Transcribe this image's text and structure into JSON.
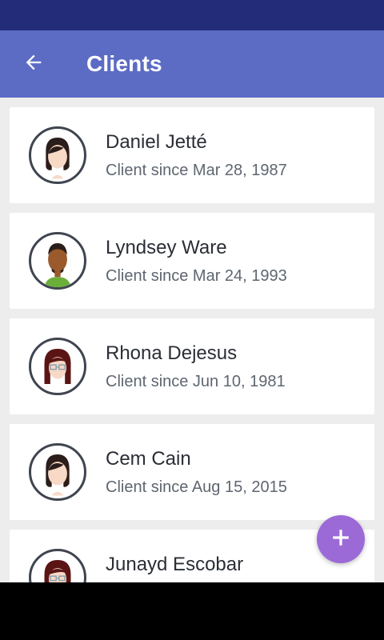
{
  "app_bar": {
    "title": "Clients",
    "back_icon": "arrow-back-icon"
  },
  "clients": [
    {
      "name": "Daniel Jetté",
      "since": "Client since Mar 28, 1987",
      "avatar": "female-avatar"
    },
    {
      "name": "Lyndsey Ware",
      "since": "Client since Mar 24, 1993",
      "avatar": "male-avatar"
    },
    {
      "name": "Rhona Dejesus",
      "since": "Client since Jun 10, 1981",
      "avatar": "female-glasses-avatar"
    },
    {
      "name": "Cem Cain",
      "since": "Client since Aug 15, 2015",
      "avatar": "female-avatar"
    },
    {
      "name": "Junayd Escobar",
      "since": "",
      "avatar": "female-glasses-avatar"
    }
  ],
  "fab": {
    "icon": "add-icon"
  },
  "colors": {
    "status_bar": "#222c78",
    "app_bar": "#5c6bc4",
    "background": "#ededed",
    "fab": "#9b6ad7",
    "name_text": "#2a2e35",
    "secondary_text": "#5f6670"
  }
}
